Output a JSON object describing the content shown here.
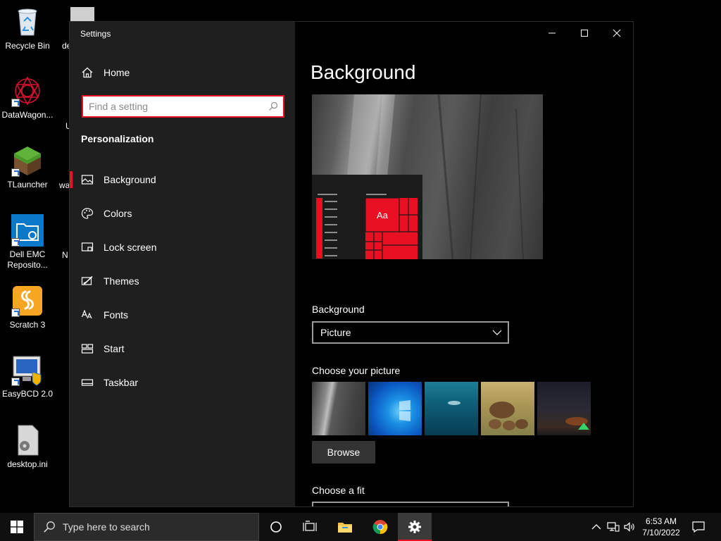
{
  "desktop": {
    "icons": [
      {
        "label": "Recycle Bin"
      },
      {
        "label": "DataWagon..."
      },
      {
        "label": "TLauncher"
      },
      {
        "label": "Dell EMC Reposito..."
      },
      {
        "label": "Scratch 3"
      },
      {
        "label": "EasyBCD 2.0"
      },
      {
        "label": "desktop.ini"
      }
    ],
    "partial_labels": [
      "de",
      "U",
      "wa",
      "N"
    ]
  },
  "settings": {
    "window_title": "Settings",
    "home_label": "Home",
    "search_placeholder": "Find a setting",
    "section_heading": "Personalization",
    "nav": [
      {
        "label": "Background"
      },
      {
        "label": "Colors"
      },
      {
        "label": "Lock screen"
      },
      {
        "label": "Themes"
      },
      {
        "label": "Fonts"
      },
      {
        "label": "Start"
      },
      {
        "label": "Taskbar"
      }
    ],
    "active_nav": "Background"
  },
  "content": {
    "page_title": "Background",
    "preview_tile_text": "Aa",
    "background_label": "Background",
    "background_value": "Picture",
    "choose_picture_label": "Choose your picture",
    "browse_label": "Browse",
    "choose_fit_label": "Choose a fit"
  },
  "taskbar": {
    "search_placeholder": "Type here to search",
    "time": "6:53 AM",
    "date": "7/10/2022"
  },
  "colors": {
    "accent": "#e81123",
    "sidebar_bg": "#1f1f1f",
    "content_bg": "#000000"
  }
}
